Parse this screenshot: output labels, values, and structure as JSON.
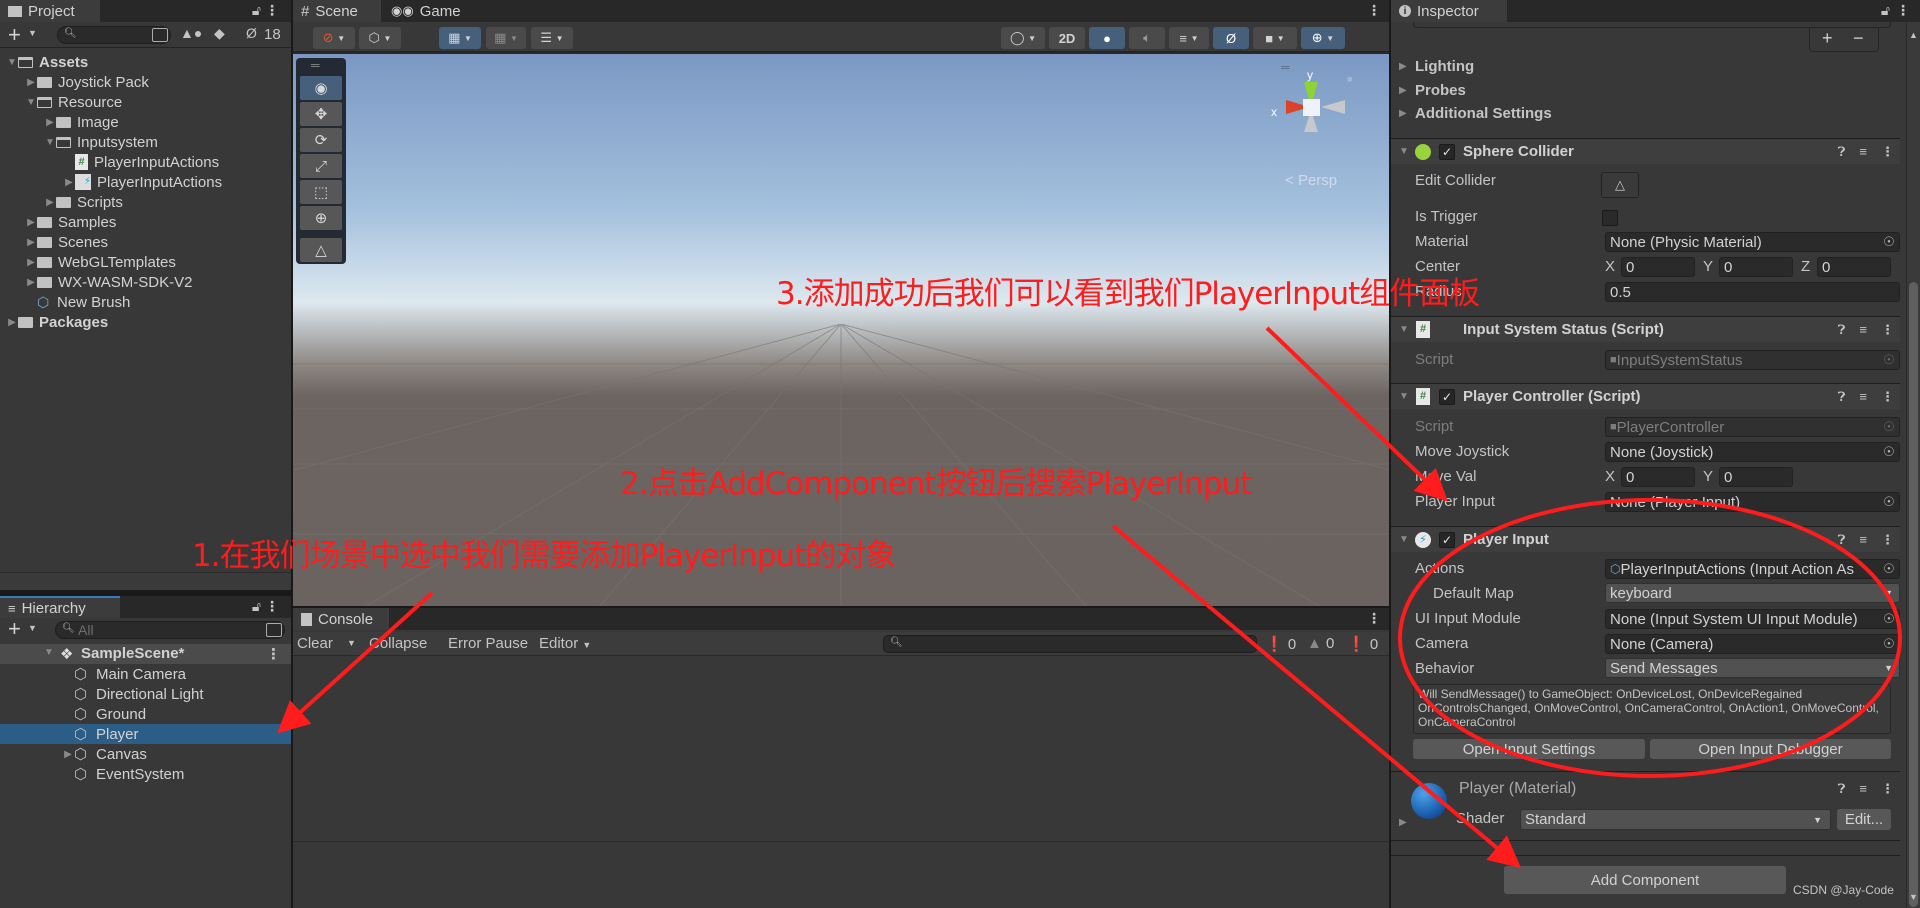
{
  "project": {
    "tab_label": "Project",
    "hidden_count": "18",
    "search_placeholder": "",
    "tree": [
      {
        "label": "Assets",
        "depth": 0,
        "expanded": true,
        "kind": "folder-open",
        "bold": true
      },
      {
        "label": "Joystick Pack",
        "depth": 1,
        "expanded": false,
        "kind": "folder"
      },
      {
        "label": "Resource",
        "depth": 1,
        "expanded": true,
        "kind": "folder-open"
      },
      {
        "label": "Image",
        "depth": 2,
        "expanded": false,
        "kind": "folder"
      },
      {
        "label": "Inputsystem",
        "depth": 2,
        "expanded": true,
        "kind": "folder-open"
      },
      {
        "label": "PlayerInputActions",
        "depth": 3,
        "kind": "script"
      },
      {
        "label": "PlayerInputActions",
        "depth": 3,
        "expanded": false,
        "kind": "input-actions"
      },
      {
        "label": "Scripts",
        "depth": 2,
        "expanded": false,
        "kind": "folder"
      },
      {
        "label": "Samples",
        "depth": 1,
        "expanded": false,
        "kind": "folder"
      },
      {
        "label": "Scenes",
        "depth": 1,
        "expanded": false,
        "kind": "folder"
      },
      {
        "label": "WebGLTemplates",
        "depth": 1,
        "expanded": false,
        "kind": "folder"
      },
      {
        "label": "WX-WASM-SDK-V2",
        "depth": 1,
        "expanded": false,
        "kind": "folder"
      },
      {
        "label": "New Brush",
        "depth": 1,
        "kind": "brush"
      },
      {
        "label": "Packages",
        "depth": 0,
        "expanded": false,
        "kind": "folder",
        "bold": true
      }
    ]
  },
  "hierarchy": {
    "tab_label": "Hierarchy",
    "search_placeholder": "All",
    "scene_name": "SampleScene*",
    "items": [
      {
        "label": "Main Camera",
        "selected": false,
        "has_children": false
      },
      {
        "label": "Directional Light",
        "selected": false,
        "has_children": false
      },
      {
        "label": "Ground",
        "selected": false,
        "has_children": false
      },
      {
        "label": "Player",
        "selected": true,
        "has_children": false
      },
      {
        "label": "Canvas",
        "selected": false,
        "has_children": true
      },
      {
        "label": "EventSystem",
        "selected": false,
        "has_children": false
      }
    ]
  },
  "scene": {
    "tabs": [
      {
        "label": "Scene",
        "active": true
      },
      {
        "label": "Game",
        "active": false
      }
    ],
    "toolbar": {
      "mode_2d": "2D"
    },
    "gizmo": {
      "x_label": "x",
      "y_label": "y",
      "projection": "Persp"
    },
    "tools": [
      "view-tool",
      "move-tool",
      "rotate-tool",
      "scale-tool",
      "rect-tool",
      "transform-tool",
      "custom-tool"
    ]
  },
  "console": {
    "tab_label": "Console",
    "buttons": {
      "clear": "Clear",
      "collapse": "Collapse",
      "error_pause": "Error Pause",
      "editor": "Editor"
    },
    "counts": {
      "log": "0",
      "warning": "0",
      "error": "0"
    }
  },
  "inspector": {
    "tab_label": "Inspector",
    "camera_sections": [
      "Lighting",
      "Probes",
      "Additional Settings"
    ],
    "sphere_collider": {
      "title": "Sphere Collider",
      "edit_collider_label": "Edit Collider",
      "is_trigger_label": "Is Trigger",
      "material_label": "Material",
      "material_value": "None (Physic Material)",
      "center_label": "Center",
      "center": {
        "x": "0",
        "y": "0",
        "z": "0"
      },
      "radius_label": "Radius",
      "radius_value": "0.5"
    },
    "input_system_status": {
      "title": "Input System Status (Script)",
      "script_label": "Script",
      "script_value": "InputSystemStatus"
    },
    "player_controller": {
      "title": "Player Controller (Script)",
      "script_label": "Script",
      "script_value": "PlayerController",
      "move_joystick_label": "Move Joystick",
      "move_joystick_value": "None (Joystick)",
      "move_val_label": "Move Val",
      "move_val": {
        "x": "0",
        "y": "0"
      },
      "player_input_label": "Player Input",
      "player_input_value": "None (Player Input)"
    },
    "player_input": {
      "title": "Player Input",
      "actions_label": "Actions",
      "actions_value": "PlayerInputActions (Input Action As",
      "default_map_label": "Default Map",
      "default_map_value": "keyboard",
      "ui_input_module_label": "UI Input Module",
      "ui_input_module_value": "None (Input System UI Input Module)",
      "camera_label": "Camera",
      "camera_value": "None (Camera)",
      "behavior_label": "Behavior",
      "behavior_value": "Send Messages",
      "help_text": "Will SendMessage() to GameObject: OnDeviceLost, OnDeviceRegained OnControlsChanged, OnMoveControl, OnCameraControl, OnAction1, OnMoveControl, OnCameraControl",
      "open_settings_label": "Open Input Settings",
      "open_debugger_label": "Open Input Debugger"
    },
    "material": {
      "title": "Player (Material)",
      "shader_label": "Shader",
      "shader_value": "Standard",
      "edit_label": "Edit..."
    },
    "add_component_label": "Add Component"
  },
  "annotations": {
    "step1": "1.在我们场景中选中我们需要添加PlayerInput的对象",
    "step2": "2.点击AddComponent按钮后搜索PlayerInput",
    "step3": "3.添加成功后我们可以看到我们PlayerInput组件面板",
    "color": "#ff1c1c"
  },
  "watermark": "CSDN @Jay-Code"
}
